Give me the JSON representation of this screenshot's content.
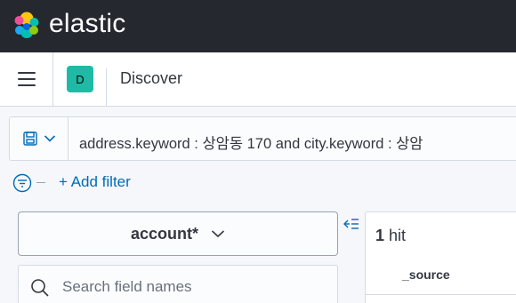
{
  "header": {
    "logo_text": "elastic"
  },
  "nav": {
    "space_initial": "D",
    "breadcrumb": "Discover"
  },
  "query": {
    "text": "address.keyword : 상암동 170 and city.keyword : 상암"
  },
  "filters": {
    "add_filter_label": "+ Add filter"
  },
  "sidebar": {
    "index_pattern": "account*",
    "search_placeholder": "Search field names"
  },
  "results": {
    "hit_count": "1",
    "hit_label": "hit",
    "column_header": "_source"
  },
  "colors": {
    "topbar_bg": "#25282f",
    "space_badge": "#20b9a6",
    "link": "#006bb8",
    "text": "#343741"
  }
}
